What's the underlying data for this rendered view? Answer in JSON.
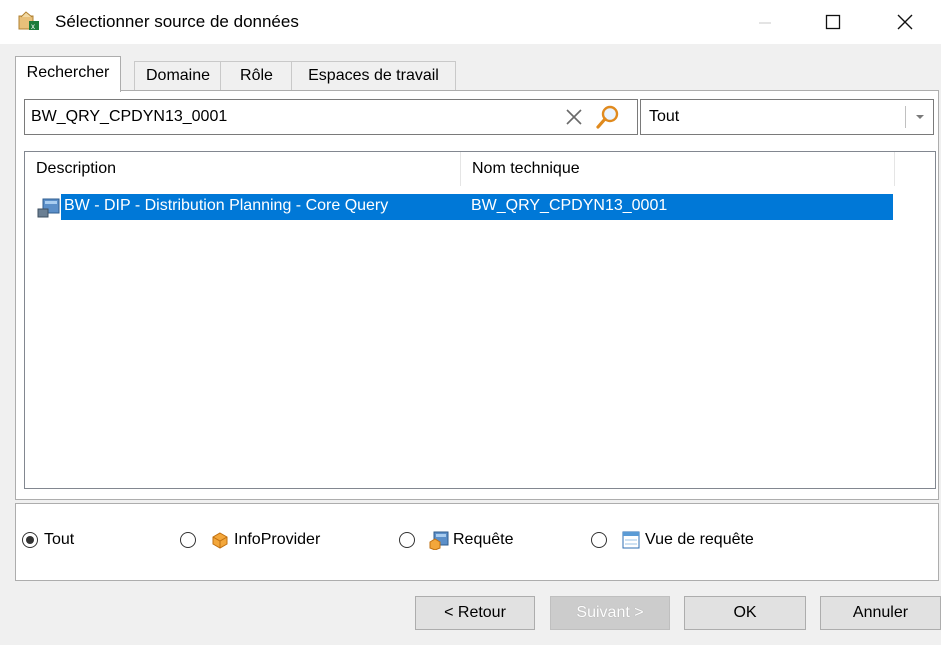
{
  "window": {
    "title": "Sélectionner source de données"
  },
  "tabs": [
    {
      "label": "Rechercher",
      "active": true
    },
    {
      "label": "Domaine",
      "active": false
    },
    {
      "label": "Rôle",
      "active": false
    },
    {
      "label": "Espaces de travail",
      "active": false
    }
  ],
  "search": {
    "value": "BW_QRY_CPDYN13_0001",
    "scope_value": "Tout"
  },
  "list": {
    "columns": [
      "Description",
      "Nom technique"
    ],
    "rows": [
      {
        "description": "BW - DIP - Distribution Planning - Core Query",
        "technical_name": "BW_QRY_CPDYN13_0001",
        "selected": true,
        "icon": "query-icon"
      }
    ]
  },
  "filters": [
    {
      "label": "Tout",
      "checked": true,
      "icon": null
    },
    {
      "label": "InfoProvider",
      "checked": false,
      "icon": "infoprovider-icon"
    },
    {
      "label": "Requête",
      "checked": false,
      "icon": "query-icon"
    },
    {
      "label": "Vue de requête",
      "checked": false,
      "icon": "query-view-icon"
    }
  ],
  "buttons": {
    "back": "< Retour",
    "next": "Suivant >",
    "ok": "OK",
    "cancel": "Annuler"
  },
  "colors": {
    "selection": "#0078d7",
    "background": "#f0f0f0"
  }
}
